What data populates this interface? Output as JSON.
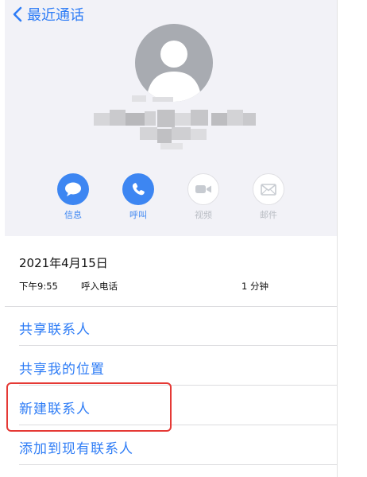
{
  "nav": {
    "back_label": "最近通话"
  },
  "actions": [
    {
      "label": "信息",
      "icon": "message-bubble-icon",
      "enabled": true
    },
    {
      "label": "呼叫",
      "icon": "phone-icon",
      "enabled": true
    },
    {
      "label": "视频",
      "icon": "video-camera-icon",
      "enabled": false
    },
    {
      "label": "邮件",
      "icon": "mail-envelope-icon",
      "enabled": false
    }
  ],
  "call": {
    "date": "2021年4月15日",
    "time": "下午9:55",
    "type": "呼入电话",
    "duration": "1 分钟"
  },
  "options": [
    {
      "label": "共享联系人"
    },
    {
      "label": "共享我的位置"
    },
    {
      "label": "新建联系人"
    },
    {
      "label": "添加到现有联系人"
    }
  ],
  "colors": {
    "accent": "#2f7df6",
    "header_bg": "#f2f2f7",
    "disabled": "#b9bdc4",
    "highlight": "#e53935"
  }
}
